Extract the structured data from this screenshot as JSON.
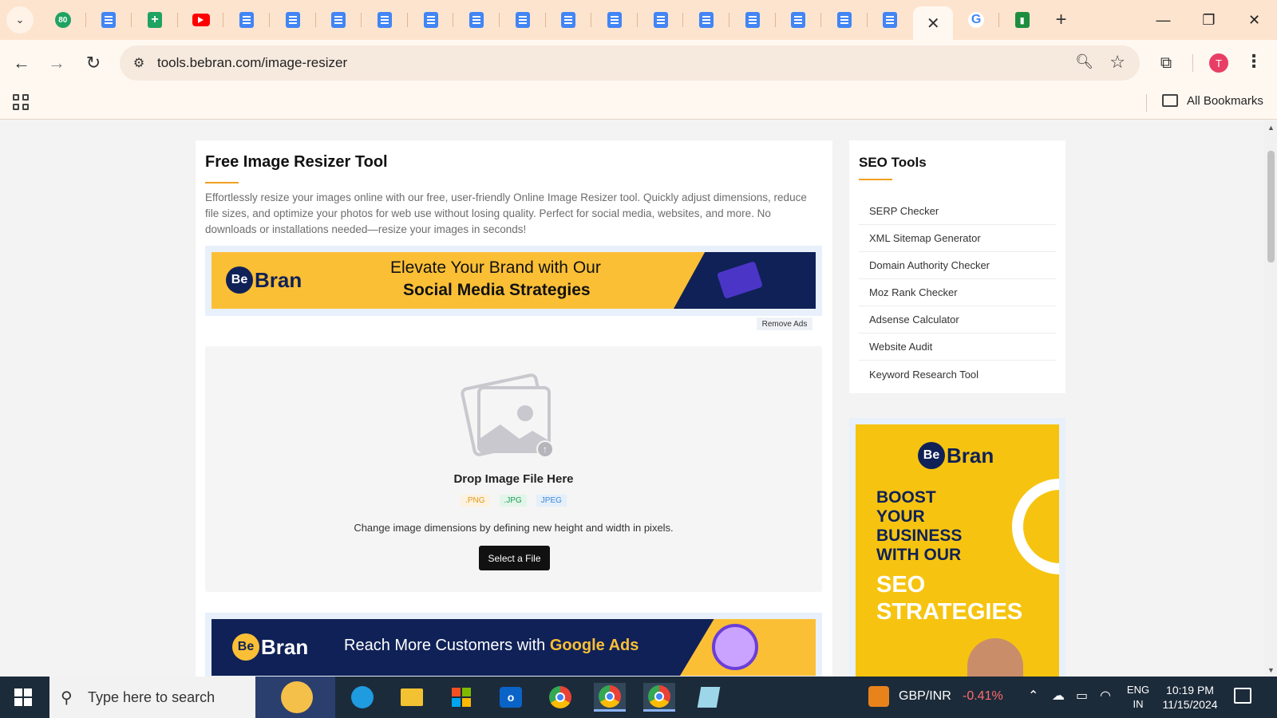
{
  "browser": {
    "tab_close_glyph": "✕",
    "new_tab_glyph": "+",
    "url": "tools.bebran.com/image-resizer",
    "avatar_initial": "T",
    "bookmarks_label": "All Bookmarks"
  },
  "page": {
    "title": "Free Image Resizer Tool",
    "description": "Effortlessly resize your images online with our free, user-friendly Online Image Resizer tool. Quickly adjust dimensions, reduce file sizes, and optimize your photos for web use without losing quality. Perfect for social media, websites, and more. No downloads or installations needed—resize your images in seconds!",
    "ad1": {
      "logo": "Bran",
      "logo_badge": "Be",
      "line1": "Elevate Your Brand with Our",
      "line2": "Social Media Strategies"
    },
    "remove_ads": "Remove Ads",
    "uploader": {
      "title": "Drop Image File Here",
      "formats": [
        ".PNG",
        ".JPG",
        "JPEG"
      ],
      "hint": "Change image dimensions by defining new height and width in pixels.",
      "button": "Select a File"
    },
    "ad2": {
      "logo": "Bran",
      "logo_badge": "Be",
      "text_plain": "Reach More Customers with ",
      "text_bold": "Google Ads"
    }
  },
  "sidebar": {
    "title": "SEO Tools",
    "items": [
      {
        "label": "SERP Checker"
      },
      {
        "label": "XML Sitemap Generator"
      },
      {
        "label": "Domain Authority Checker"
      },
      {
        "label": "Moz Rank Checker"
      },
      {
        "label": "Adsense Calculator"
      },
      {
        "label": "Website Audit"
      },
      {
        "label": "Keyword Research Tool"
      }
    ],
    "ad": {
      "logo": "Bran",
      "logo_badge": "Be",
      "boost": "BOOST YOUR BUSINESS WITH OUR",
      "seo": "SEO STRATEGIES"
    }
  },
  "taskbar": {
    "search_placeholder": "Type here to search",
    "stock_pair": "GBP/INR",
    "stock_change": "-0.41%",
    "lang_top": "ENG",
    "lang_bottom": "IN",
    "time": "10:19 PM",
    "date": "11/15/2024"
  },
  "colors": {
    "accent": "#f2a01f",
    "brand_navy": "#0f2157",
    "brand_yellow": "#fbbf36",
    "tabstrip": "#fde4cf"
  }
}
